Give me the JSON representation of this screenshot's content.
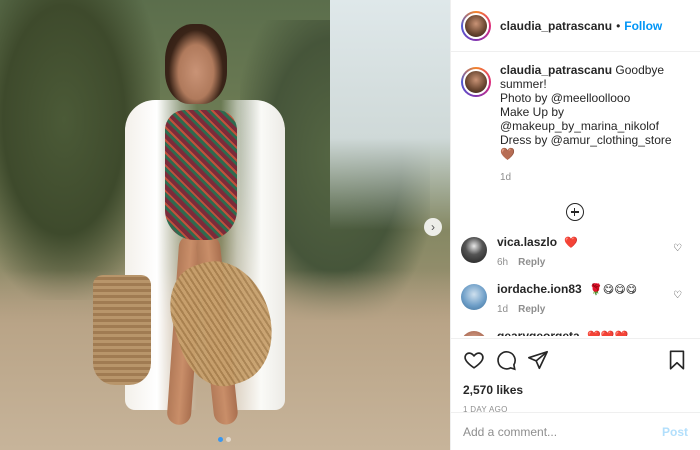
{
  "header": {
    "username": "claudia_patrascanu",
    "separator": "•",
    "follow_label": "Follow"
  },
  "caption": {
    "username": "claudia_patrascanu",
    "lines": [
      "Goodbye summer!",
      "Photo by @meelloollooo",
      "Make Up by",
      "@makeup_by_marina_nikolof",
      "Dress by @amur_clothing_store🤎"
    ],
    "time": "1d"
  },
  "comments": [
    {
      "username": "vica.laszlo",
      "text": "❤️",
      "time": "6h",
      "reply_label": "Reply",
      "avatar_color": "#1c1c1c"
    },
    {
      "username": "iordache.ion83",
      "text": "🌹😋😋😋",
      "time": "1d",
      "reply_label": "Reply",
      "avatar_color": "#6f9fc8"
    },
    {
      "username": "gearygeorgeta",
      "text": "❤️❤️❤️",
      "time": "",
      "reply_label": "",
      "avatar_color": "#b0705a"
    }
  ],
  "likes": "2,570 likes",
  "timestamp": "1 DAY AGO",
  "add_comment": {
    "placeholder": "Add a comment...",
    "post_label": "Post"
  },
  "carousel": {
    "slide_count": 2,
    "active_index": 0
  },
  "colors": {
    "link": "#0095f6",
    "muted": "#8e8e8e",
    "text": "#262626",
    "post_disabled": "#b2dffc"
  }
}
